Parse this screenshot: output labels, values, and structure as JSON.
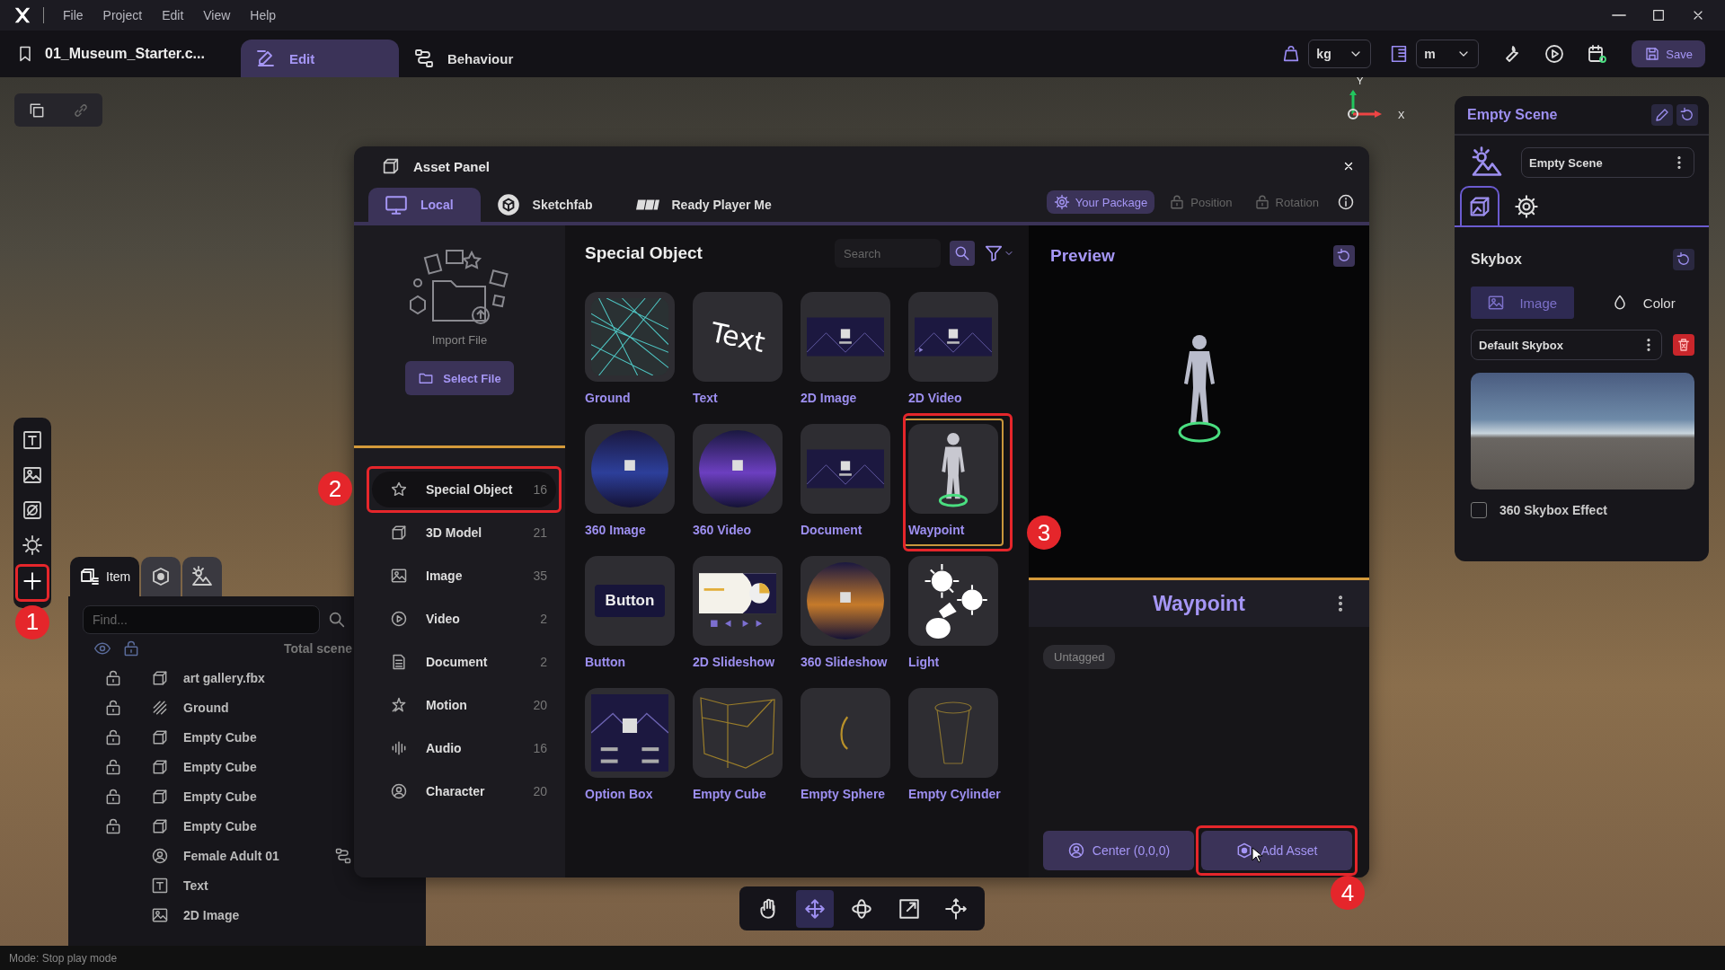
{
  "menu": [
    "File",
    "Project",
    "Edit",
    "View",
    "Help"
  ],
  "project": {
    "name": "01_Museum_Starter.c..."
  },
  "mode_tabs": [
    {
      "label": "Edit",
      "selected": true
    },
    {
      "label": "Behaviour",
      "selected": false
    }
  ],
  "units": [
    {
      "value": "kg"
    },
    {
      "value": "m"
    }
  ],
  "save_label": "Save",
  "viewport": {
    "axis_labels": [
      "Y",
      "X"
    ]
  },
  "left_toolbar": {
    "add_callout": "1"
  },
  "scene_panel": {
    "tabs": [
      {
        "label": "Item",
        "selected": true
      },
      {
        "selected": false
      },
      {
        "selected": false
      }
    ],
    "search_placeholder": "Find...",
    "header_label": "Total scene",
    "rows": [
      {
        "name": "art gallery.fbx",
        "kind": "cube",
        "locked": true,
        "behaviour": false
      },
      {
        "name": "Ground",
        "kind": "ground",
        "locked": true,
        "behaviour": false
      },
      {
        "name": "Empty Cube",
        "kind": "cube",
        "locked": true,
        "behaviour": false
      },
      {
        "name": "Empty Cube",
        "kind": "cube",
        "locked": true,
        "behaviour": false
      },
      {
        "name": "Empty Cube",
        "kind": "cube",
        "locked": true,
        "behaviour": false
      },
      {
        "name": "Empty Cube",
        "kind": "cube",
        "locked": true,
        "behaviour": false
      },
      {
        "name": "Female Adult 01",
        "kind": "character",
        "locked": false,
        "behaviour": true
      },
      {
        "name": "Text",
        "kind": "text",
        "locked": false,
        "behaviour": false
      },
      {
        "name": "2D Image",
        "kind": "image",
        "locked": false,
        "behaviour": false
      }
    ]
  },
  "asset_panel": {
    "title": "Asset Panel",
    "sources": [
      {
        "label": "Local",
        "selected": true
      },
      {
        "label": "Sketchfab",
        "selected": false
      },
      {
        "label": "Ready Player Me",
        "selected": false
      }
    ],
    "toggles": [
      {
        "label": "Your Package",
        "active": true
      },
      {
        "label": "Position",
        "active": false
      },
      {
        "label": "Rotation",
        "active": false
      }
    ],
    "import_label": "Import File",
    "select_file": "Select File",
    "categories": [
      {
        "label": "Special Object",
        "count": "16",
        "selected": true,
        "callout": "2"
      },
      {
        "label": "3D Model",
        "count": "21",
        "selected": false
      },
      {
        "label": "Image",
        "count": "35",
        "selected": false
      },
      {
        "label": "Video",
        "count": "2",
        "selected": false
      },
      {
        "label": "Document",
        "count": "2",
        "selected": false
      },
      {
        "label": "Motion",
        "count": "20",
        "selected": false
      },
      {
        "label": "Audio",
        "count": "16",
        "selected": false
      },
      {
        "label": "Character",
        "count": "20",
        "selected": false
      }
    ],
    "grid_title": "Special Object",
    "search_placeholder": "Search",
    "assets": [
      {
        "label": "Ground",
        "kind": "grid",
        "selected": false
      },
      {
        "label": "Text",
        "kind": "text",
        "thumb_text": "Text",
        "selected": false
      },
      {
        "label": "2D Image",
        "kind": "image",
        "selected": false
      },
      {
        "label": "2D Video",
        "kind": "video",
        "selected": false
      },
      {
        "label": "360 Image",
        "kind": "sphere",
        "selected": false
      },
      {
        "label": "360 Video",
        "kind": "sphere-video",
        "selected": false
      },
      {
        "label": "Document",
        "kind": "document",
        "selected": false
      },
      {
        "label": "Waypoint",
        "kind": "figure",
        "selected": true,
        "callout": "3"
      },
      {
        "label": "Button",
        "kind": "button",
        "thumb_text": "Button",
        "selected": false
      },
      {
        "label": "2D Slideshow",
        "kind": "slides",
        "selected": false
      },
      {
        "label": "360 Slideshow",
        "kind": "sphere-sunset",
        "selected": false
      },
      {
        "label": "Light",
        "kind": "light",
        "selected": false
      },
      {
        "label": "Option Box",
        "kind": "option",
        "selected": false
      },
      {
        "label": "Empty Cube",
        "kind": "wire-cube",
        "selected": false
      },
      {
        "label": "Empty Sphere",
        "kind": "wire-sphere",
        "selected": false
      },
      {
        "label": "Empty Cylinder",
        "kind": "wire-cylinder",
        "selected": false
      }
    ],
    "preview_title": "Preview",
    "selected_name": "Waypoint",
    "tag": "Untagged",
    "center_button": "Center (0,0,0)",
    "add_button": {
      "label": "Add Asset",
      "callout": "4"
    }
  },
  "right_panel": {
    "title": "Empty Scene",
    "scene_select": "Empty Scene",
    "tabs": [
      {
        "selected": true
      },
      {
        "selected": false
      }
    ],
    "section": "Skybox",
    "modes": [
      {
        "label": "Image",
        "selected": true
      },
      {
        "label": "Color",
        "selected": false
      }
    ],
    "skybox_select": "Default Skybox",
    "checkbox": {
      "label": "360 Skybox Effect",
      "checked": false
    }
  },
  "status": "Mode: Stop play mode"
}
